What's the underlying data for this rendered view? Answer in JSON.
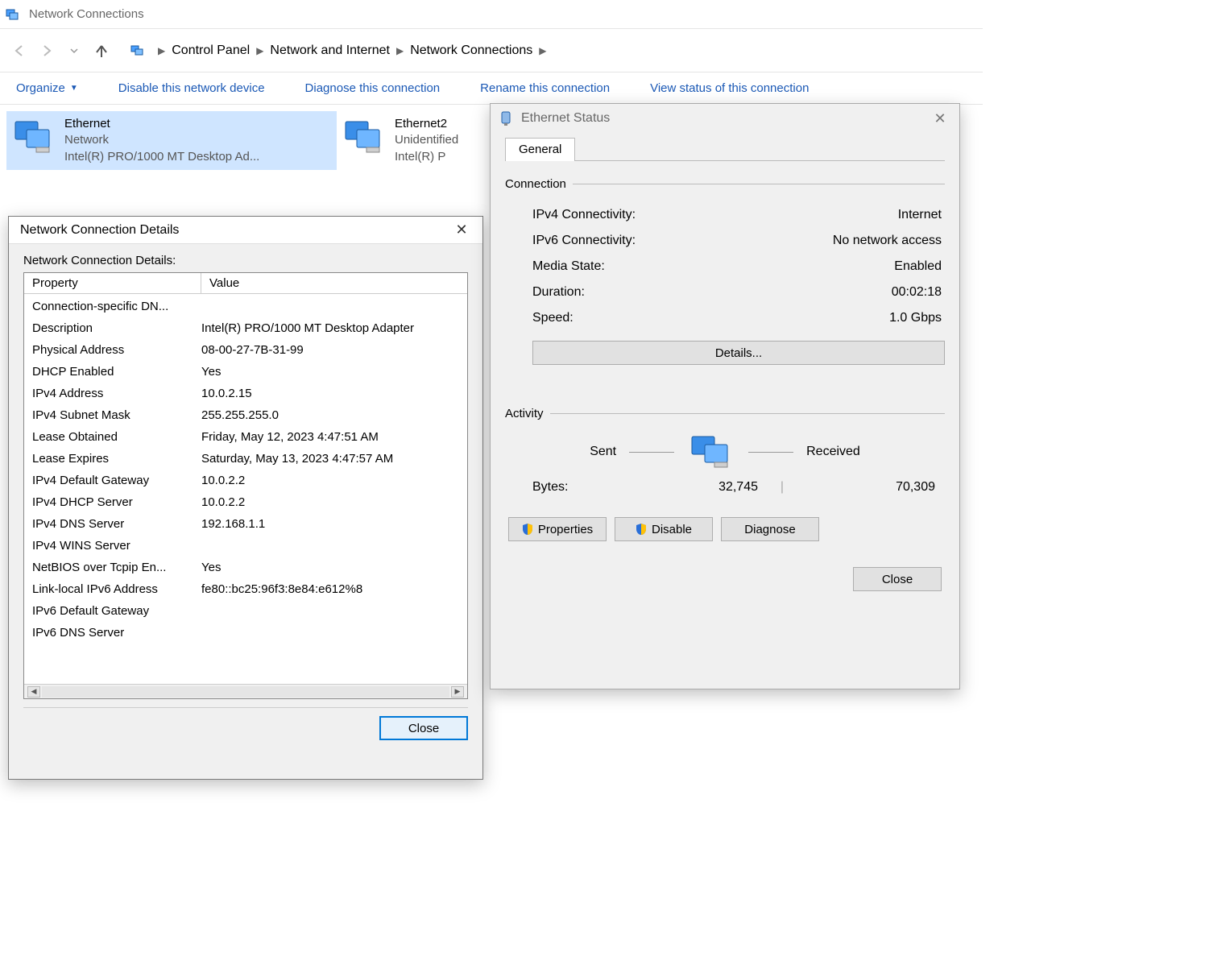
{
  "window": {
    "title": "Network Connections"
  },
  "breadcrumb": {
    "items": [
      "Control Panel",
      "Network and Internet",
      "Network Connections"
    ]
  },
  "toolbar": {
    "organize": "Organize",
    "disable": "Disable this network device",
    "diagnose": "Diagnose this connection",
    "rename": "Rename this connection",
    "viewstatus": "View status of this connection"
  },
  "adapters": [
    {
      "name": "Ethernet",
      "status": "Network",
      "device": "Intel(R) PRO/1000 MT Desktop Ad..."
    },
    {
      "name": "Ethernet2",
      "status": "Unidentified",
      "device": "Intel(R) P"
    }
  ],
  "details_dialog": {
    "title": "Network Connection Details",
    "label": "Network Connection Details:",
    "header_property": "Property",
    "header_value": "Value",
    "close": "Close",
    "rows": [
      {
        "p": "Connection-specific DN...",
        "v": ""
      },
      {
        "p": "Description",
        "v": "Intel(R) PRO/1000 MT Desktop Adapter"
      },
      {
        "p": "Physical Address",
        "v": "08-00-27-7B-31-99"
      },
      {
        "p": "DHCP Enabled",
        "v": "Yes"
      },
      {
        "p": "IPv4 Address",
        "v": "10.0.2.15"
      },
      {
        "p": "IPv4 Subnet Mask",
        "v": "255.255.255.0"
      },
      {
        "p": "Lease Obtained",
        "v": "Friday, May 12, 2023 4:47:51 AM"
      },
      {
        "p": "Lease Expires",
        "v": "Saturday, May 13, 2023 4:47:57 AM"
      },
      {
        "p": "IPv4 Default Gateway",
        "v": "10.0.2.2"
      },
      {
        "p": "IPv4 DHCP Server",
        "v": "10.0.2.2"
      },
      {
        "p": "IPv4 DNS Server",
        "v": "192.168.1.1"
      },
      {
        "p": "IPv4 WINS Server",
        "v": ""
      },
      {
        "p": "NetBIOS over Tcpip En...",
        "v": "Yes"
      },
      {
        "p": "Link-local IPv6 Address",
        "v": "fe80::bc25:96f3:8e84:e612%8"
      },
      {
        "p": "IPv6 Default Gateway",
        "v": ""
      },
      {
        "p": "IPv6 DNS Server",
        "v": ""
      }
    ]
  },
  "status_dialog": {
    "title": "Ethernet Status",
    "tab": "General",
    "group_connection": "Connection",
    "group_activity": "Activity",
    "conn": {
      "ipv4_k": "IPv4 Connectivity:",
      "ipv4_v": "Internet",
      "ipv6_k": "IPv6 Connectivity:",
      "ipv6_v": "No network access",
      "media_k": "Media State:",
      "media_v": "Enabled",
      "dur_k": "Duration:",
      "dur_v": "00:02:18",
      "speed_k": "Speed:",
      "speed_v": "1.0 Gbps"
    },
    "details_btn": "Details...",
    "activity": {
      "sent_label": "Sent",
      "recv_label": "Received",
      "bytes_label": "Bytes:",
      "sent_bytes": "32,745",
      "recv_bytes": "70,309"
    },
    "buttons": {
      "properties": "Properties",
      "disable": "Disable",
      "diagnose": "Diagnose",
      "close": "Close"
    }
  }
}
